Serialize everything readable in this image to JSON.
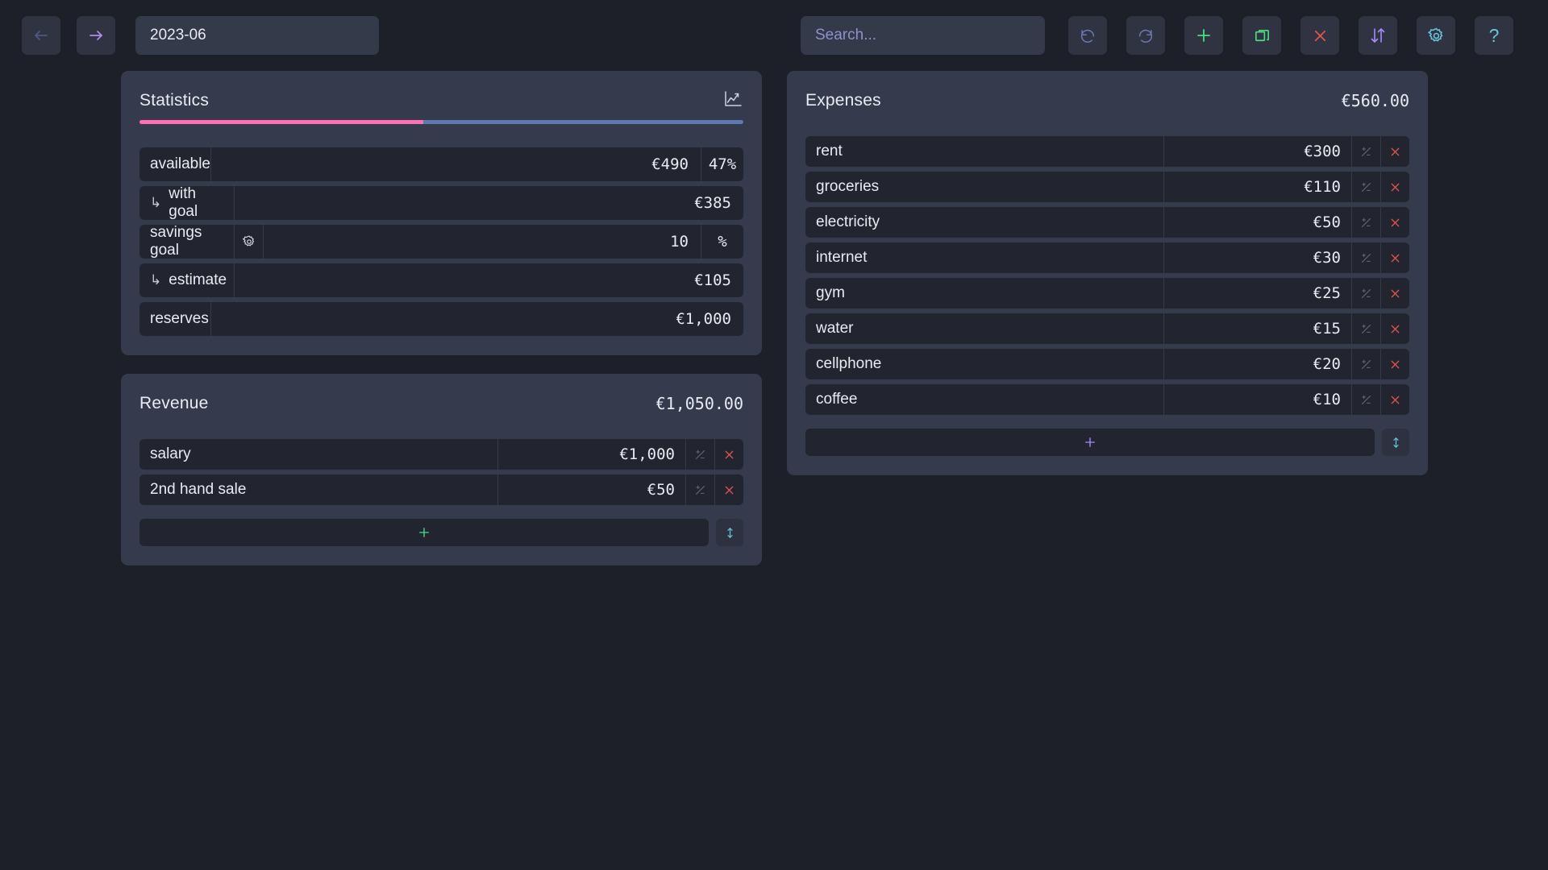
{
  "toolbar": {
    "back_icon": "arrow-left-icon",
    "forward_icon": "arrow-right-icon",
    "date_value": "2023-06",
    "search_placeholder": "Search...",
    "search_value": "",
    "buttons": [
      {
        "name": "undo",
        "icon": "undo-icon",
        "color": "#6c7bb5"
      },
      {
        "name": "redo",
        "icon": "redo-icon",
        "color": "#6c7bb5"
      },
      {
        "name": "add",
        "icon": "plus-icon",
        "color": "#4ade80"
      },
      {
        "name": "copy",
        "icon": "copy-icon",
        "color": "#4ade80"
      },
      {
        "name": "clear",
        "icon": "close-icon",
        "color": "#e0564f"
      },
      {
        "name": "sort",
        "icon": "sort-updown-icon",
        "color": "#a78bfa"
      },
      {
        "name": "settings",
        "icon": "gear-icon",
        "color": "#67c7d8"
      },
      {
        "name": "help",
        "icon": "question-icon",
        "color": "#67c7d8"
      }
    ]
  },
  "statistics": {
    "title": "Statistics",
    "chart_icon": "line-chart-icon",
    "progress": {
      "filled_percent": 47,
      "filled_color": "#ff6fb6",
      "rest_color": "#5d79ae"
    },
    "rows": [
      {
        "label": "available",
        "sub": false,
        "label_width": 88,
        "value": "€490",
        "unit": "47%",
        "gear": false
      },
      {
        "label": "with goal",
        "sub": true,
        "label_width": 117,
        "value": "€385",
        "unit": "",
        "gear": false
      },
      {
        "label": "savings goal",
        "sub": false,
        "label_width": 117,
        "value": "10",
        "unit": "%",
        "gear": true
      },
      {
        "label": "estimate",
        "sub": true,
        "label_width": 117,
        "value": "€105",
        "unit": "",
        "gear": false
      },
      {
        "label": "reserves",
        "sub": false,
        "label_width": 88,
        "value": "€1,000",
        "unit": "",
        "gear": false
      }
    ]
  },
  "revenue": {
    "title": "Revenue",
    "total": "€1,050.00",
    "add_icon": "plus-icon",
    "add_color": "#4ade80",
    "sort_icon": "sort-vertical-icon",
    "items": [
      {
        "name": "salary",
        "amount": "€1,000"
      },
      {
        "name": "2nd hand sale",
        "amount": "€50"
      }
    ]
  },
  "expenses": {
    "title": "Expenses",
    "total": "€560.00",
    "add_icon": "plus-icon",
    "add_color": "#a78bfa",
    "sort_icon": "sort-vertical-icon",
    "items": [
      {
        "name": "rent",
        "amount": "€300"
      },
      {
        "name": "groceries",
        "amount": "€110"
      },
      {
        "name": "electricity",
        "amount": "€50"
      },
      {
        "name": "internet",
        "amount": "€30"
      },
      {
        "name": "gym",
        "amount": "€25"
      },
      {
        "name": "water",
        "amount": "€15"
      },
      {
        "name": "cellphone",
        "amount": "€20"
      },
      {
        "name": "coffee",
        "amount": "€10"
      }
    ]
  },
  "row_actions": {
    "toggle_icon": "plus-minus-icon",
    "delete_icon": "close-icon",
    "toggle_color": "#5e6478",
    "delete_color": "#e0564f"
  }
}
